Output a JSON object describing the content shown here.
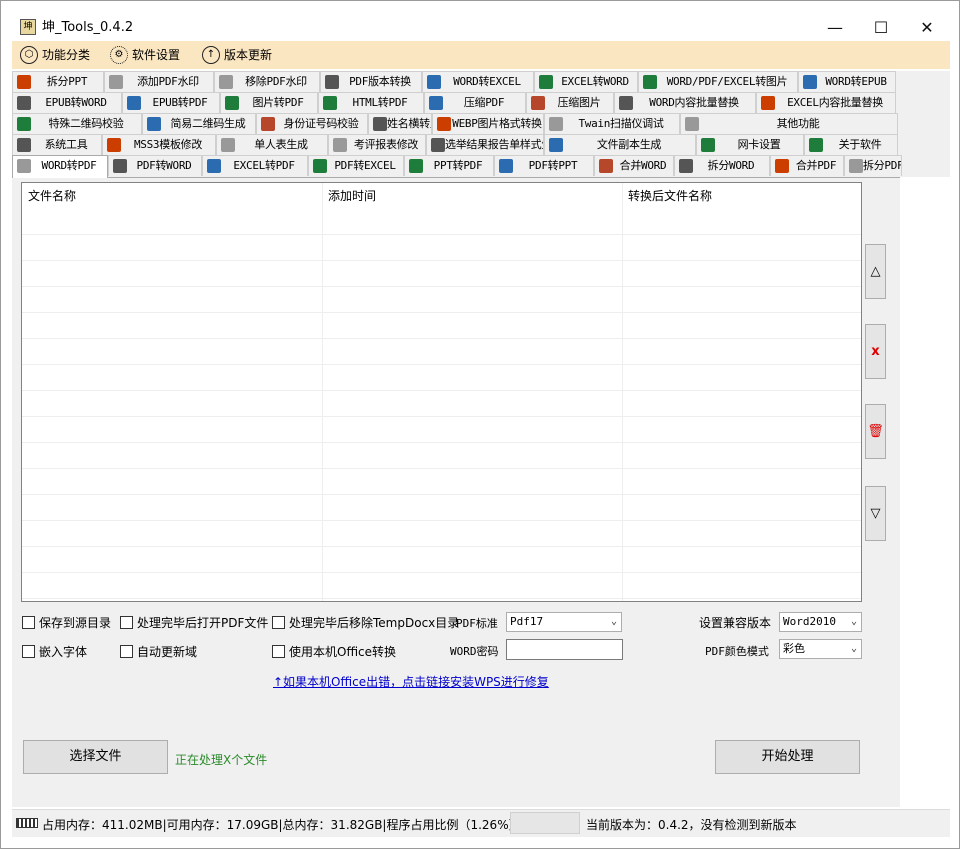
{
  "window": {
    "title": "坤_Tools_0.4.2",
    "minimize": "—",
    "maximize": "☐",
    "close": "✕"
  },
  "menu": [
    {
      "label": "功能分类",
      "icon": "hexagon-icon"
    },
    {
      "label": "软件设置",
      "icon": "gear-icon"
    },
    {
      "label": "版本更新",
      "icon": "arrow-up-circle-icon"
    }
  ],
  "tabs": [
    [
      "拆分PPT",
      "添加PDF水印",
      "移除PDF水印",
      "PDF版本转换",
      "WORD转EXCEL",
      "EXCEL转WORD",
      "WORD/PDF/EXCEL转图片",
      "WORD转EPUB"
    ],
    [
      "EPUB转WORD",
      "EPUB转PDF",
      "图片转PDF",
      "HTML转PDF",
      "压缩PDF",
      "压缩图片",
      "WORD内容批量替换",
      "EXCEL内容批量替换"
    ],
    [
      "特殊二维码校验",
      "简易二维码生成",
      "身份证号码校验",
      "姓名横转竖列",
      "WEBP图片格式转换",
      "Twain扫描仪调试",
      "其他功能"
    ],
    [
      "系统工具",
      "MSS3模板修改",
      "单人表生成",
      "考评报表修改",
      "选举结果报告单样式生成",
      "文件副本生成",
      "网卡设置",
      "关于软件"
    ],
    [
      "WORD转PDF",
      "PDF转WORD",
      "EXCEL转PDF",
      "PDF转EXCEL",
      "PPT转PDF",
      "PDF转PPT",
      "合并WORD",
      "拆分WORD",
      "合并PDF",
      "拆分PDF"
    ]
  ],
  "grid": {
    "columns": [
      "文件名称",
      "添加时间",
      "转换后文件名称"
    ]
  },
  "side_buttons": {
    "up": "△",
    "delete": "x",
    "clear": "🗑",
    "down": "▽"
  },
  "options": {
    "save_to_source": "保存到源目录",
    "open_pdf_after": "处理完毕后打开PDF文件",
    "remove_tempdocx": "处理完毕后移除TempDocx目录",
    "pdf_standard_label": "PDF标准",
    "pdf_standard_value": "Pdf17",
    "compat_label": "设置兼容版本",
    "compat_value": "Word2010",
    "embed_fonts": "嵌入字体",
    "auto_update_fields": "自动更新域",
    "use_local_office": "使用本机Office转换",
    "word_password_label": "WORD密码",
    "word_password_value": "",
    "pdf_color_label": "PDF颜色模式",
    "pdf_color_value": "彩色"
  },
  "link_text": "↑如果本机Office出错，点击链接安装WPS进行修复",
  "buttons": {
    "select_file": "选择文件",
    "start": "开始处理"
  },
  "processing_text": "正在处理X个文件",
  "status": {
    "memory": "占用内存：411.02MB|可用内存：17.09GB|总内存：31.82GB|程序占用比例（1.26%）",
    "version": "当前版本为：0.4.2，没有检测到新版本"
  }
}
